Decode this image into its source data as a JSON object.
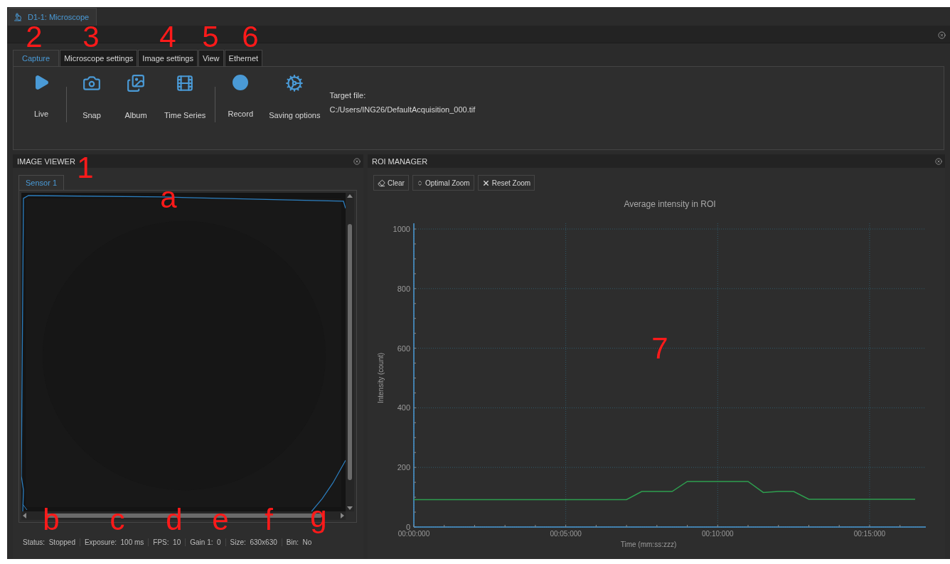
{
  "document_tab": {
    "title": "D1-1: Microscope"
  },
  "ribbon": {
    "tabs": [
      {
        "label": "Capture",
        "selected": true
      },
      {
        "label": "Microscope settings",
        "selected": false
      },
      {
        "label": "Image settings",
        "selected": false
      },
      {
        "label": "View",
        "selected": false
      },
      {
        "label": "Ethernet",
        "selected": false
      }
    ],
    "tools": [
      {
        "kind": "play",
        "label": "Live"
      },
      {
        "kind": "separator"
      },
      {
        "kind": "camera",
        "label": "Snap"
      },
      {
        "kind": "album",
        "label": "Album"
      },
      {
        "kind": "film",
        "label": "Time Series"
      },
      {
        "kind": "separator"
      },
      {
        "kind": "record",
        "label": "Record"
      },
      {
        "kind": "gears",
        "label": "Saving options"
      }
    ],
    "target_file": {
      "label": "Target file:",
      "path": "C:/Users/ING26/DefaultAcquisition_000.tif"
    }
  },
  "image_viewer": {
    "title": "IMAGE VIEWER",
    "tabs": [
      {
        "label": "Sensor 1",
        "selected": true
      }
    ],
    "status_bar": [
      {
        "label": "Status:",
        "value": "Stopped"
      },
      {
        "label": "Exposure:",
        "value": "100 ms"
      },
      {
        "label": "FPS:",
        "value": "10"
      },
      {
        "label": "Gain 1:",
        "value": "0"
      },
      {
        "label": "Size:",
        "value": "630x630"
      },
      {
        "label": "Bin:",
        "value": "No"
      }
    ]
  },
  "roi_manager": {
    "title": "ROI MANAGER",
    "buttons": [
      {
        "kind": "eraser",
        "label": "Clear"
      },
      {
        "kind": "fit",
        "label": "Optimal Zoom"
      },
      {
        "kind": "reset",
        "label": "Reset Zoom"
      }
    ],
    "chart_data": {
      "type": "line",
      "title": "Average intensity in ROI",
      "xlabel": "Time (mm:ss:zzz)",
      "ylabel": "Intensity (count)",
      "categories": [
        "00:00:000",
        null,
        null,
        null,
        null,
        null,
        null,
        null,
        null,
        null,
        "00:05:000",
        null,
        null,
        null,
        null,
        null,
        null,
        null,
        null,
        null,
        "00:10:000",
        null,
        null,
        null,
        null,
        null,
        null,
        null,
        null,
        null,
        "00:15:000",
        null,
        null,
        null
      ],
      "series": [
        {
          "color": "#2e9e4f",
          "values": [
            92,
            92,
            92,
            92,
            92,
            92,
            92,
            92,
            92,
            92,
            92,
            92,
            92,
            92,
            92,
            119,
            119,
            119,
            153,
            153,
            153,
            153,
            153,
            116,
            119,
            119,
            93,
            93,
            93,
            93,
            93,
            93,
            93,
            93
          ]
        }
      ],
      "grid": true,
      "ylim": [
        0,
        1000
      ],
      "yticks": [
        0,
        200,
        400,
        600,
        800,
        1000
      ]
    }
  },
  "annotations": [
    "1",
    "2",
    "3",
    "4",
    "5",
    "6",
    "7",
    "a",
    "b",
    "c",
    "d",
    "e",
    "f",
    "g"
  ]
}
